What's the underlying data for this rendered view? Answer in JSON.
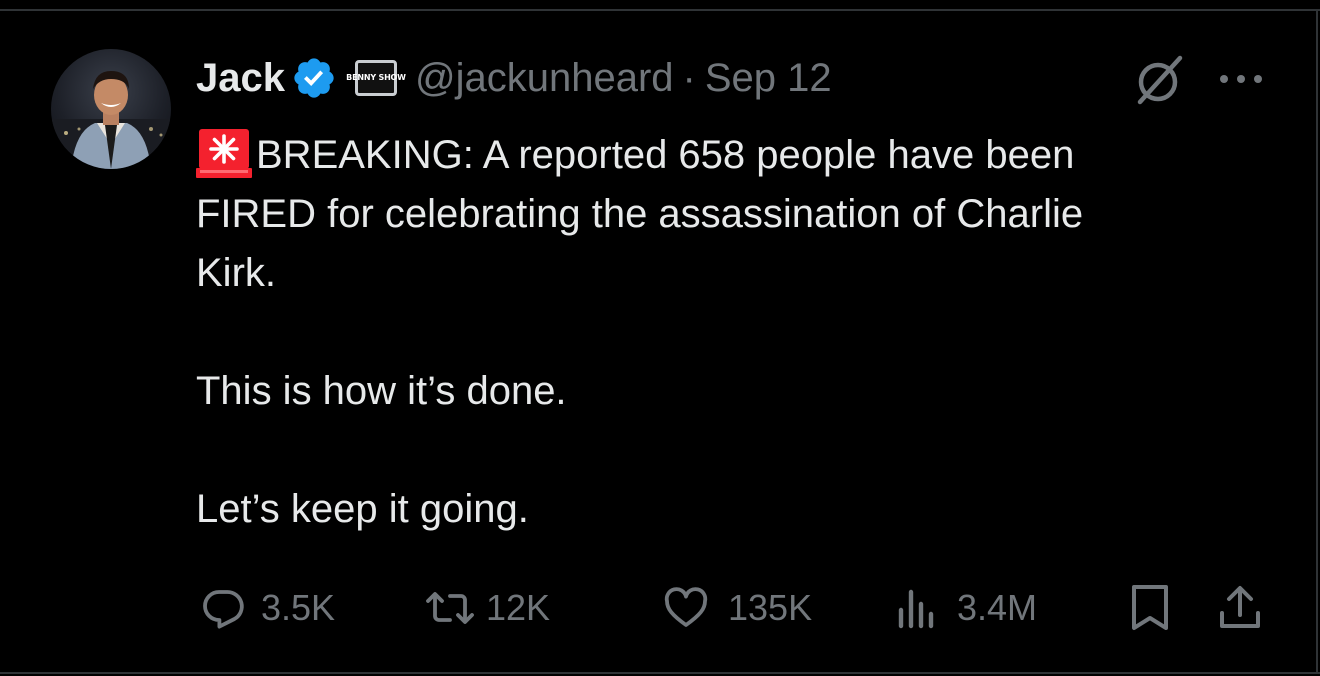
{
  "author": {
    "name": "Jack",
    "handle": "@jackunheard",
    "separator": "·",
    "date": "Sep 12",
    "affiliate_badge": "BENNY SHOW",
    "verified": true,
    "verified_color": "#1d9bf0"
  },
  "tweet": {
    "lead_emoji": "siren-icon",
    "line1": "BREAKING: A reported 658 people have been\nFIRED for celebrating the assassination of Charlie\nKirk.",
    "line2": "This is how it’s done.",
    "line3": "Let’s keep it going."
  },
  "actions": {
    "replies": "3.5K",
    "reposts": "12K",
    "likes": "135K",
    "views": "3.4M"
  },
  "icons": {
    "reply": "reply-icon",
    "repost": "repost-icon",
    "like": "heart-icon",
    "views": "views-icon",
    "bookmark": "bookmark-icon",
    "share": "share-icon",
    "grok": "grok-icon",
    "more": "more-icon"
  },
  "colors": {
    "background": "#000000",
    "text": "#e7e9ea",
    "secondary": "#71767b",
    "siren": "#f4212e"
  }
}
